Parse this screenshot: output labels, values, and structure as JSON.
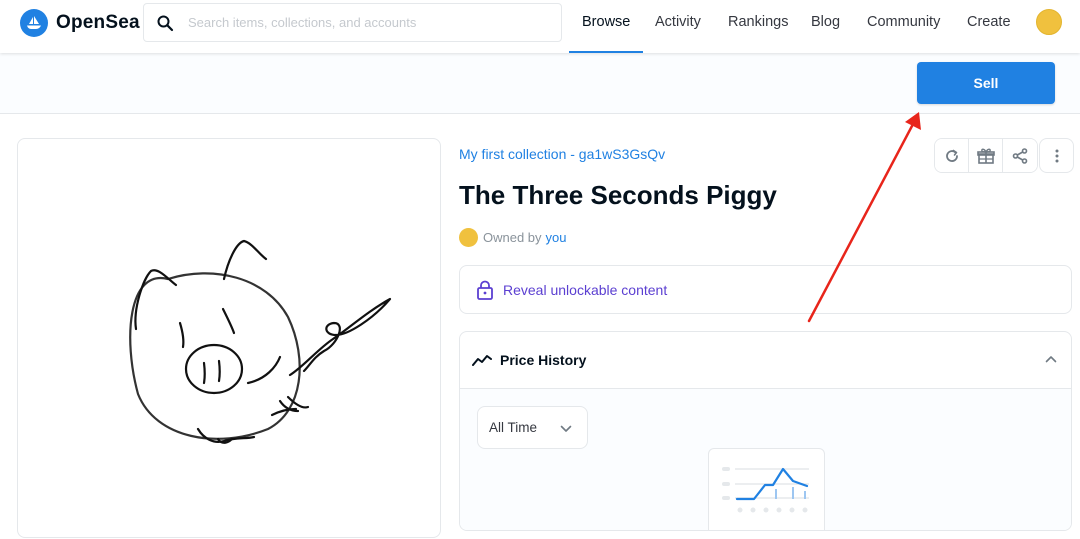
{
  "header": {
    "logo_text": "OpenSea",
    "search": {
      "placeholder": "Search items, collections, and accounts",
      "value": ""
    },
    "nav": [
      {
        "label": "Browse",
        "active": true
      },
      {
        "label": "Activity",
        "active": false
      },
      {
        "label": "Rankings",
        "active": false
      },
      {
        "label": "Blog",
        "active": false
      },
      {
        "label": "Community",
        "active": false
      },
      {
        "label": "Create",
        "active": false
      }
    ],
    "accent_color": "#2081e2"
  },
  "actionbar": {
    "sell_label": "Sell"
  },
  "item": {
    "collection": "My first collection - ga1wS3GsQv",
    "title": "The Three Seconds Piggy",
    "owned_by_prefix": "Owned by",
    "owner": "you",
    "image": "pig-drawing"
  },
  "toolbar": {
    "icons": [
      "refresh-icon",
      "gift-icon",
      "share-icon",
      "more-vertical-icon"
    ]
  },
  "unlockable": {
    "label": "Reveal unlockable content",
    "icon": "lock-icon",
    "color": "#5b3fd1"
  },
  "price_history": {
    "title": "Price History",
    "time_filter": "All Time",
    "icon": "trend-line-icon"
  },
  "annotation": {
    "type": "red-arrow",
    "color": "#e8251b",
    "points_to": "sell-button"
  }
}
